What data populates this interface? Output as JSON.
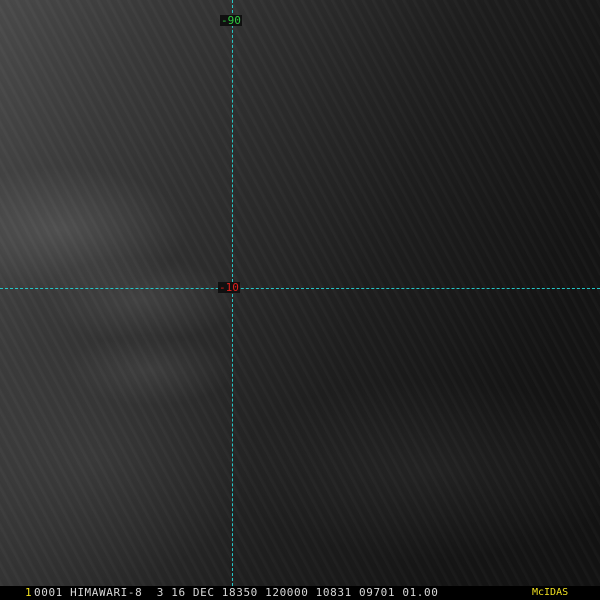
{
  "image": {
    "grid": {
      "longitude_label": "-90",
      "latitude_label": "-10",
      "line_color": "#26c6c6"
    }
  },
  "status_bar": {
    "frame_number": "1",
    "header_text": "0001 HIMAWARI-8  3 16 DEC 18350 120000 10831 09701 01.00",
    "software_label": "McIDAS",
    "frame_color": "#f0e020",
    "text_color": "#d8d8d8"
  }
}
